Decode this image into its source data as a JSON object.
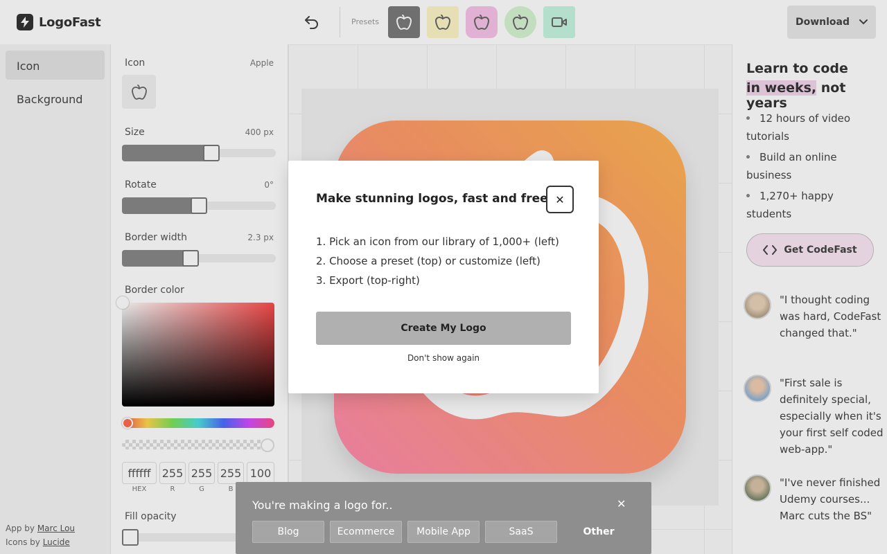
{
  "header": {
    "brand": "LogoFast",
    "presets_label": "Presets",
    "presets": [
      {
        "name": "preset-dark",
        "bg": "#7a7a7a",
        "icon_color": "#ffffff"
      },
      {
        "name": "preset-yellow",
        "bg": "#fdf6c8",
        "icon_color": "#666666"
      },
      {
        "name": "preset-pink",
        "bg": "#f7c3e8",
        "icon_color": "#666666"
      },
      {
        "name": "preset-green",
        "bg": "#d6f5d2",
        "icon_color": "#666666"
      },
      {
        "name": "preset-mint",
        "bg": "#c6f6e2",
        "icon_color": "#666666"
      }
    ],
    "download_label": "Download"
  },
  "nav": {
    "items": [
      "Icon",
      "Background"
    ],
    "credits_app_prefix": "App by",
    "credits_app_link": "Marc Lou",
    "credits_icons_prefix": "Icons by",
    "credits_icons_link": "Lucide"
  },
  "settings": {
    "icon_label": "Icon",
    "icon_value": "Apple",
    "size_label": "Size",
    "size_value": "400 px",
    "size_fraction": 0.59,
    "rotate_label": "Rotate",
    "rotate_value": "0°",
    "rotate_fraction": 0.5,
    "border_width_label": "Border width",
    "border_width_value": "2.3 px",
    "border_width_fraction": 0.44,
    "border_color_label": "Border color",
    "hex": "ffffff",
    "r": "255",
    "g": "255",
    "b": "255",
    "a": "100",
    "hex_label": "HEX",
    "r_label": "R",
    "g_label": "G",
    "b_label": "B",
    "fill_opacity_label": "Fill opacity"
  },
  "ad": {
    "heading_line1": "Learn to code",
    "heading_highlight": "in weeks,",
    "heading_rest": " not years",
    "bullets": [
      "12 hours of video tutorials",
      "Build an online business",
      "1,270+ happy students"
    ],
    "cta": "Get CodeFast",
    "testimonials": [
      "\"I thought coding was hard, CodeFast changed that.\"",
      "\"First sale is definitely special, especially when it's your first self coded web-app.\"",
      "\"I've never finished Udemy courses... Marc cuts the BS\""
    ]
  },
  "modal": {
    "title": "Make stunning logos, fast and free!",
    "steps": [
      "1. Pick an icon from our library of 1,000+ (left)",
      "2. Choose a preset (top) or customize (left)",
      "3. Export (top-right)"
    ],
    "create_label": "Create My Logo",
    "dont_show_label": "Don't show again"
  },
  "survey": {
    "title": "You're making a logo for..",
    "options": [
      "Blog",
      "Ecommerce",
      "Mobile App",
      "SaaS",
      "Other"
    ]
  },
  "colors": {
    "accent_pink": "#f3d6ec",
    "logo_gradient_start": "#ffb454",
    "logo_gradient_end": "#ff8ab0"
  }
}
